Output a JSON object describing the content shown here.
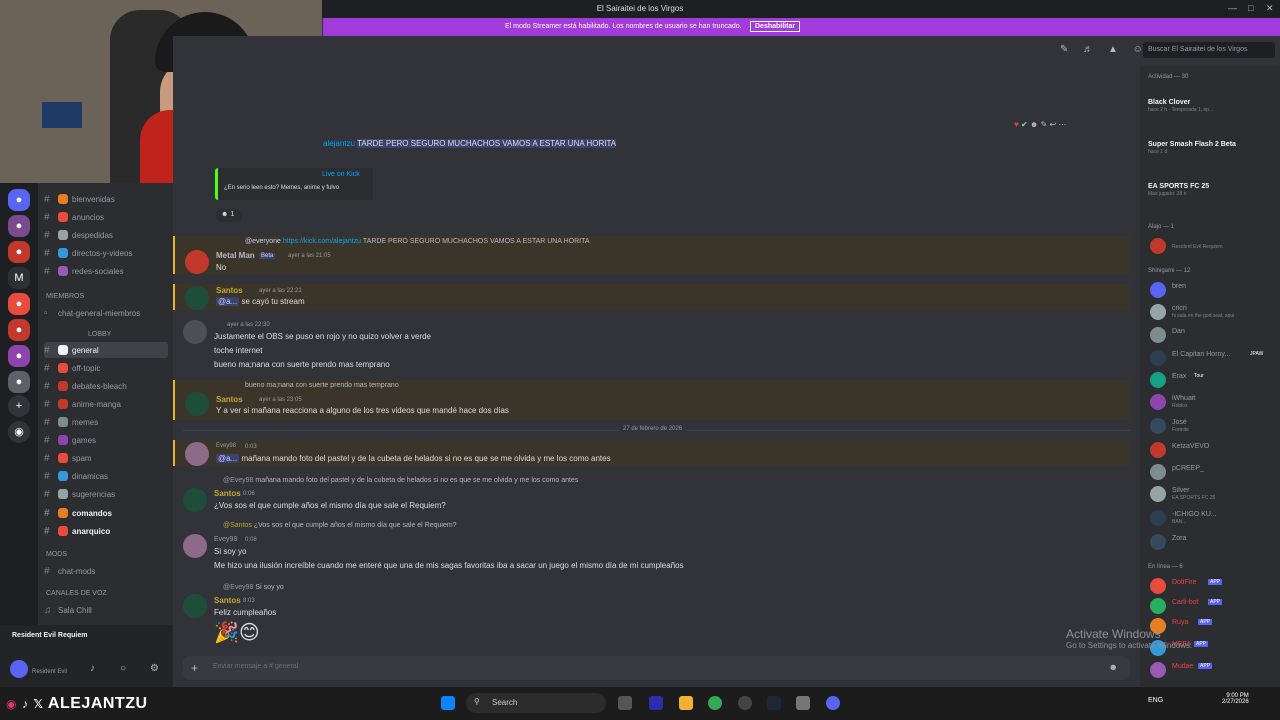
{
  "window": {
    "title": "El Sairaitei de los Virgos"
  },
  "banner": {
    "message": "El modo Streamer está habilitado. Los nombres de usuario se han truncado.",
    "button": "Deshabilitar"
  },
  "header": {
    "search_placeholder": "Buscar El Sairaitei de los Virgos"
  },
  "channels": {
    "items": [
      {
        "name": "bienvenidas"
      },
      {
        "name": "anuncios"
      },
      {
        "name": "despedidas"
      },
      {
        "name": "directos-y-videos"
      },
      {
        "name": "redes-sociales"
      }
    ],
    "cat_members": "MIEMBROS",
    "members_chat": "chat-general-miembros",
    "cat_lobby": "LOBBY",
    "lobby": [
      {
        "name": "general"
      },
      {
        "name": "off-topic"
      },
      {
        "name": "debates-bleach"
      },
      {
        "name": "anime-manga"
      },
      {
        "name": "memes"
      },
      {
        "name": "games"
      },
      {
        "name": "spam"
      },
      {
        "name": "dinamicas"
      },
      {
        "name": "sugerencias"
      },
      {
        "name": "comandos"
      },
      {
        "name": "anarquico"
      }
    ],
    "cat_mods": "Mods",
    "mods": "chat-mods",
    "cat_voice": "CANALES DE VOZ",
    "voice": "Sala Chill"
  },
  "userpanel": {
    "activity": "Resident Evil Requiem",
    "status": "Resident Evil"
  },
  "messages": {
    "top_line": "TARDE PERO SEGURO MUCHACHOS VAMOS A ESTAR UNA HORITA",
    "top_link_handle": "alejantzu",
    "embed_line": "¿En serio leen esto? Memes, anime y fulvo",
    "embed_title": "Live on Kick",
    "reaction_count": "1",
    "m1": {
      "reply_everyone": "@everyone",
      "reply_link": "https://kick.com/alejantzu",
      "reply_text": "TARDE PERO SEGURO MUCHACHOS VAMOS A ESTAR UNA HORITA",
      "author": "Metal Man",
      "badge": "Beta",
      "stamp": "ayer a las 21:05",
      "text": "No"
    },
    "m2": {
      "author": "Santos",
      "stamp": "ayer a las 22:21",
      "mention": "@a...",
      "text": "se cayó tu stream"
    },
    "m3": {
      "stamp": "ayer a las 22:30",
      "line1": "Justamente el OBS se puso en rojo y no quizo volver a verde",
      "line2": "toche internet",
      "line3": "bueno ma;nana con suerte prendo mas temprano"
    },
    "m4": {
      "reply": "bueno ma;nana con suerte prendo mas temprano",
      "author": "Santos",
      "stamp": "ayer a las 23:05",
      "text": "Y a ver si mañana reacciona a alguno de los tres videos que mandé hace dos días"
    },
    "date_divider": "27 de febrero de 2026",
    "m5": {
      "author": "Evey98",
      "stamp": "0:03",
      "mention": "@a...",
      "text": "mañana mando foto del pastel y de la cubeta de helados si no es que se me olvida y me los como antes"
    },
    "m6": {
      "reply": "mañana mando foto del pastel y de la cubeta de helados si no es que se me olvida y me los como antes",
      "reply_user": "@Evey98",
      "author": "Santos",
      "stamp": "0:06",
      "text": "¿Vos sos el que cumple años el mismo día que sale el Requiem?"
    },
    "m7": {
      "reply_user": "@Santos",
      "reply": "¿Vos sos el que cumple años el mismo día que sale el Requiem?",
      "author": "Evey98",
      "stamp": "0:08",
      "line1": "Si soy yo",
      "line2": "Me hizo una ilusión increíble cuando me enteré que una de mis sagas favoritas iba a sacar un juego el mismo día de mi cumpleaños"
    },
    "m8": {
      "reply_user": "@Evey98",
      "reply": "Si soy yo",
      "author": "Santos",
      "stamp": "8:03",
      "text": "Feliz cumpleaños"
    }
  },
  "composer": {
    "placeholder": "Enviar mensaje a #",
    "channel": "general"
  },
  "members": {
    "activity_header": "Actividad — 30",
    "act": [
      {
        "name": "Black Clover",
        "sub": "hace 2 h · Temporada 1, ep..."
      },
      {
        "name": "Super Smash Flash 2 Beta",
        "sub": "hace 1 d"
      },
      {
        "name": "EA SPORTS FC 25",
        "sub": "Más jugado: 28 h"
      }
    ],
    "alajo_header": "Alajo — 1",
    "alajo": [
      {
        "name": "Resident Evil Requiem"
      }
    ],
    "shini_header": "Shinigami — 12",
    "shini": [
      {
        "name": "bren"
      },
      {
        "name": "cricri",
        "sub": "hi sala en the god seal, aqui"
      },
      {
        "name": "Dan"
      },
      {
        "name": "El Capitan Horny...",
        "tag": "JPAW"
      },
      {
        "name": "Erax",
        "tag": "Tour"
      },
      {
        "name": "iWhuait",
        "sub": "Roblox"
      },
      {
        "name": "José",
        "sub": "Fortnite"
      },
      {
        "name": "KetzaVEVO"
      },
      {
        "name": "pCREEP_"
      },
      {
        "name": "Silver",
        "sub": "EA SPORTS FC 25"
      },
      {
        "name": "-ICHIGO KU...",
        "sub": "BAN..."
      },
      {
        "name": "Zora"
      }
    ],
    "online_header": "En línea — 6",
    "online": [
      {
        "name": "DotiFire",
        "tag": "APP"
      },
      {
        "name": "Carli-bot",
        "tag": "APP"
      },
      {
        "name": "Ruya",
        "tag": "APP"
      },
      {
        "name": "MEE6",
        "tag": "APP"
      },
      {
        "name": "Mudae",
        "tag": "APP"
      }
    ]
  },
  "watermark": {
    "line1": "Activate Windows",
    "line2": "Go to Settings to activate Windows."
  },
  "taskbar": {
    "brand": "ALEJANTZU",
    "search": "Search",
    "lang": "ENG",
    "time": "9:00 PM",
    "date": "2/27/2026"
  },
  "colors": {
    "accent": "#a13bd9",
    "santos": "#c3a734",
    "evey": "#949ba4",
    "highlight": "#f0b232"
  }
}
